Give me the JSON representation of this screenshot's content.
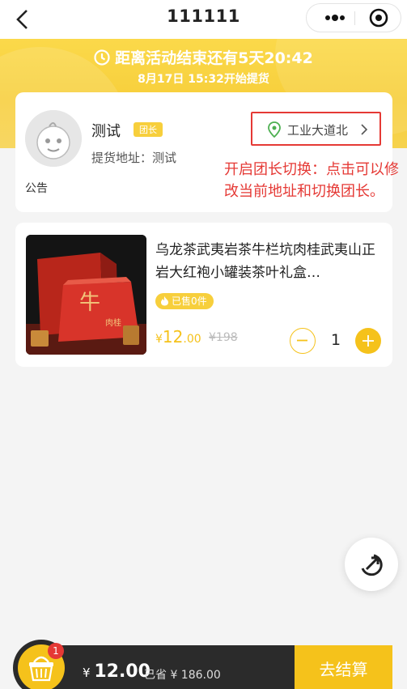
{
  "nav": {
    "title": "111111",
    "back_icon": "chevron-left-icon",
    "more_icon": "more-dots-icon",
    "close_icon": "target-close-icon"
  },
  "banner": {
    "countdown": "距离活动结束还有5天20:42",
    "pickup_time": "8月17日 15:32开始提货",
    "clock_icon": "clock-icon"
  },
  "leader": {
    "name": "测试",
    "badge": "团长",
    "pickup_label": "提货地址：",
    "pickup_value": "测试",
    "notice": "公告",
    "address_button": "工业大道北",
    "annotation": "开启团长切换：点击可以修改当前地址和切换团长。"
  },
  "product": {
    "title": "乌龙茶武夷岩茶牛栏坑肉桂武夷山正岩大红袍小罐装茶叶礼盒…",
    "sold": "已售0件",
    "currency": "¥",
    "price_int": "12",
    "price_dec": ".00",
    "original_price": "¥198",
    "quantity": "1"
  },
  "cart": {
    "count": "1",
    "total_currency": "¥",
    "total_value": "12.00",
    "saved": "已省 ¥ 186.00",
    "checkout_label": "去结算"
  },
  "colors": {
    "accent": "#f5c21b",
    "banner": "#f7cf3c",
    "annotation_red": "#e53935",
    "dark_bar": "#2b2b2b"
  }
}
